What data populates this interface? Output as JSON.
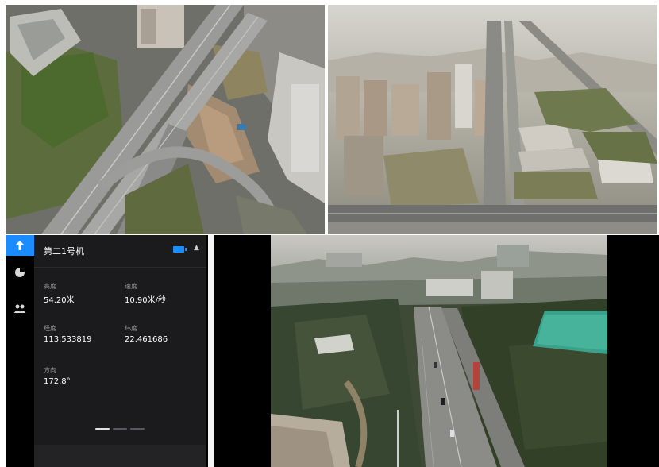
{
  "window": {
    "tiles": [
      "aerial-overpass",
      "aerial-city-haze",
      "drone-live-feed"
    ]
  },
  "sidebar": {
    "items": [
      {
        "icon": "drone-takeoff-icon",
        "active": true
      },
      {
        "icon": "pie-chart-icon",
        "active": false
      },
      {
        "icon": "users-icon",
        "active": false
      }
    ]
  },
  "panel": {
    "title": "第二1号机",
    "battery_color": "#1a8cff",
    "fields": [
      {
        "label": "高度",
        "value": "54.20米"
      },
      {
        "label": "速度",
        "value": "10.90米/秒"
      },
      {
        "label": "经度",
        "value": "113.533819"
      },
      {
        "label": "纬度",
        "value": "22.461686"
      },
      {
        "label": "方向",
        "value": "172.8°"
      }
    ],
    "pager": {
      "pages": 3,
      "current": 1
    }
  },
  "colors": {
    "accent": "#1a8cff",
    "panel_bg": "#1b1b1d",
    "background": "#000000"
  }
}
